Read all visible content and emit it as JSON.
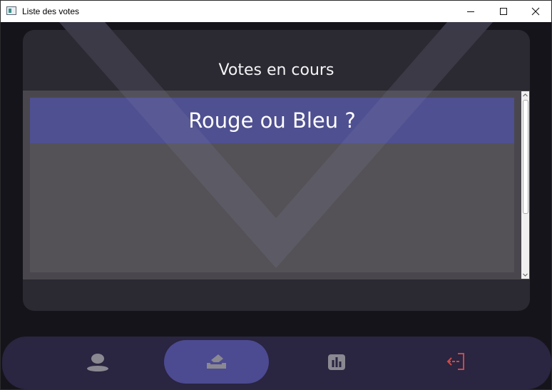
{
  "window": {
    "title": "Liste des votes",
    "controls": {
      "minimize": "minimize-icon",
      "maximize": "maximize-icon",
      "close": "close-icon"
    }
  },
  "card": {
    "title": "Votes en cours",
    "votes": [
      {
        "label": "Rouge ou Bleu ?",
        "selected": true
      }
    ]
  },
  "navbar": {
    "items": [
      {
        "icon": "user-icon",
        "active": false
      },
      {
        "icon": "vote-ballot-icon",
        "active": true
      },
      {
        "icon": "results-chart-icon",
        "active": false
      },
      {
        "icon": "logout-icon",
        "active": false,
        "color": "#c94a4a"
      }
    ]
  },
  "colors": {
    "background": "#16141b",
    "card": "#2d2b32",
    "selected_item": "#4f5091",
    "navbar": "#2a2540",
    "nav_active": "#4c4a91",
    "nav_icon": "#8a8891",
    "logout": "#c94a4a"
  }
}
